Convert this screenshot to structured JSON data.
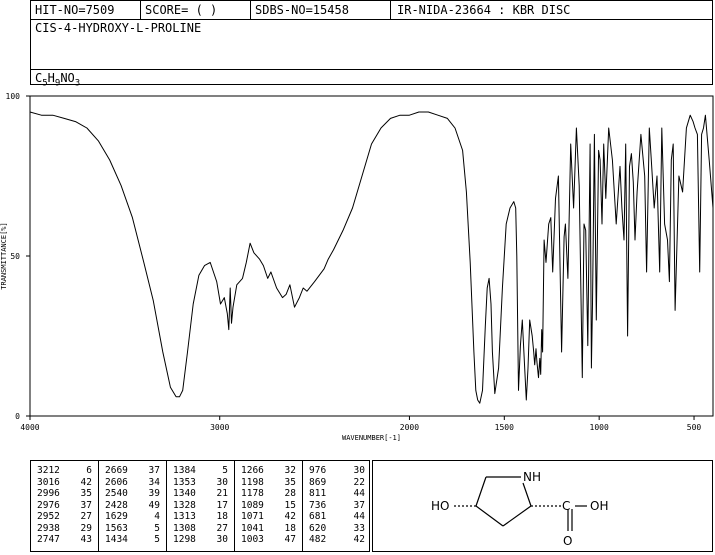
{
  "header": {
    "hit_no": "HIT-NO=7509",
    "score": "SCORE=  (   )",
    "sdbs_no": "SDBS-NO=15458",
    "ir_code": "IR-NIDA-23664 : KBR DISC",
    "compound_name": "CIS-4-HYDROXY-L-PROLINE",
    "formula": {
      "c": "C",
      "c_n": "5",
      "h": "H",
      "h_n": "9",
      "n": "N",
      "o": "O",
      "o_n": "3"
    }
  },
  "chart_data": {
    "type": "line",
    "title": "",
    "xlabel": "WAVENUMBER[-1]",
    "ylabel": "TRANSMITTANCE[%]",
    "xlim": [
      4000,
      400
    ],
    "ylim": [
      0,
      100
    ],
    "x_ticks": [
      4000,
      3000,
      2000,
      1500,
      1000,
      500
    ],
    "x_tick_labels": [
      "4000",
      "3000",
      "2000",
      "1500",
      "1000",
      "500"
    ],
    "y_ticks": [
      0,
      50,
      100
    ],
    "y_tick_labels": [
      "0",
      "50",
      "100"
    ],
    "grid": false,
    "series": [
      {
        "x": [
          4000,
          3940,
          3880,
          3820,
          3760,
          3700,
          3640,
          3580,
          3520,
          3460,
          3400,
          3350,
          3300,
          3260,
          3230,
          3212,
          3195,
          3170,
          3140,
          3110,
          3080,
          3050,
          3016,
          2996,
          2976,
          2960,
          2952,
          2945,
          2938,
          2930,
          2910,
          2880,
          2860,
          2840,
          2820,
          2790,
          2770,
          2747,
          2730,
          2700,
          2669,
          2650,
          2630,
          2606,
          2580,
          2560,
          2540,
          2500,
          2450,
          2428,
          2400,
          2350,
          2300,
          2250,
          2200,
          2150,
          2100,
          2050,
          2000,
          1950,
          1900,
          1850,
          1800,
          1760,
          1720,
          1700,
          1680,
          1660,
          1650,
          1640,
          1629,
          1615,
          1600,
          1590,
          1580,
          1570,
          1563,
          1550,
          1530,
          1510,
          1490,
          1470,
          1450,
          1440,
          1434,
          1425,
          1415,
          1405,
          1395,
          1384,
          1375,
          1366,
          1353,
          1345,
          1340,
          1333,
          1328,
          1320,
          1313,
          1308,
          1303,
          1298,
          1290,
          1280,
          1266,
          1255,
          1245,
          1230,
          1215,
          1198,
          1185,
          1178,
          1165,
          1150,
          1135,
          1120,
          1105,
          1089,
          1080,
          1071,
          1060,
          1048,
          1041,
          1035,
          1025,
          1015,
          1003,
          995,
          985,
          976,
          965,
          950,
          930,
          910,
          890,
          880,
          869,
          860,
          850,
          840,
          830,
          820,
          811,
          800,
          780,
          760,
          750,
          736,
          725,
          710,
          695,
          681,
          670,
          655,
          640,
          630,
          620,
          610,
          600,
          580,
          560,
          540,
          520,
          505,
          495,
          482,
          470,
          460,
          450,
          440,
          420,
          400
        ],
        "y": [
          95,
          94,
          94,
          93,
          92,
          90,
          86,
          80,
          72,
          62,
          48,
          36,
          20,
          9,
          6,
          6,
          8,
          20,
          35,
          44,
          47,
          48,
          42,
          35,
          37,
          32,
          27,
          40,
          29,
          34,
          41,
          43,
          48,
          54,
          51,
          49,
          47,
          43,
          45,
          40,
          37,
          38,
          41,
          34,
          37,
          40,
          39,
          42,
          46,
          49,
          52,
          58,
          65,
          75,
          85,
          90,
          93,
          94,
          94,
          95,
          95,
          94,
          93,
          90,
          83,
          70,
          48,
          20,
          8,
          5,
          4,
          8,
          28,
          40,
          43,
          35,
          20,
          7,
          15,
          40,
          60,
          65,
          67,
          65,
          50,
          8,
          22,
          30,
          18,
          5,
          15,
          30,
          25,
          20,
          16,
          21,
          17,
          12,
          18,
          13,
          27,
          20,
          55,
          48,
          60,
          62,
          45,
          68,
          75,
          20,
          56,
          60,
          43,
          85,
          65,
          90,
          72,
          12,
          60,
          58,
          22,
          85,
          15,
          35,
          88,
          30,
          83,
          80,
          60,
          85,
          68,
          90,
          80,
          60,
          78,
          65,
          55,
          85,
          25,
          78,
          82,
          73,
          55,
          70,
          88,
          75,
          45,
          90,
          80,
          65,
          75,
          45,
          90,
          60,
          55,
          42,
          80,
          85,
          33,
          75,
          70,
          90,
          94,
          92,
          90,
          88,
          45,
          88,
          90,
          94,
          80,
          65
        ]
      }
    ]
  },
  "peak_table": {
    "columns": [
      [
        [
          "3212",
          "6"
        ],
        [
          "3016",
          "42"
        ],
        [
          "2996",
          "35"
        ],
        [
          "2976",
          "37"
        ],
        [
          "2952",
          "27"
        ],
        [
          "2938",
          "29"
        ],
        [
          "2747",
          "43"
        ]
      ],
      [
        [
          "2669",
          "37"
        ],
        [
          "2606",
          "34"
        ],
        [
          "2540",
          "39"
        ],
        [
          "2428",
          "49"
        ],
        [
          "1629",
          "4"
        ],
        [
          "1563",
          "5"
        ],
        [
          "1434",
          "5"
        ]
      ],
      [
        [
          "1384",
          "5"
        ],
        [
          "1353",
          "30"
        ],
        [
          "1340",
          "21"
        ],
        [
          "1328",
          "17"
        ],
        [
          "1313",
          "18"
        ],
        [
          "1308",
          "27"
        ],
        [
          "1298",
          "30"
        ]
      ],
      [
        [
          "1266",
          "32"
        ],
        [
          "1198",
          "35"
        ],
        [
          "1178",
          "28"
        ],
        [
          "1089",
          "15"
        ],
        [
          "1071",
          "42"
        ],
        [
          "1041",
          "18"
        ],
        [
          "1003",
          "47"
        ]
      ],
      [
        [
          "976",
          "30"
        ],
        [
          "869",
          "22"
        ],
        [
          "811",
          "44"
        ],
        [
          "736",
          "37"
        ],
        [
          "681",
          "44"
        ],
        [
          "620",
          "33"
        ],
        [
          "482",
          "42"
        ]
      ]
    ]
  },
  "structure": {
    "nh_label": "NH",
    "ho_label": "HO",
    "oh_label": "OH",
    "o_label": "O"
  }
}
